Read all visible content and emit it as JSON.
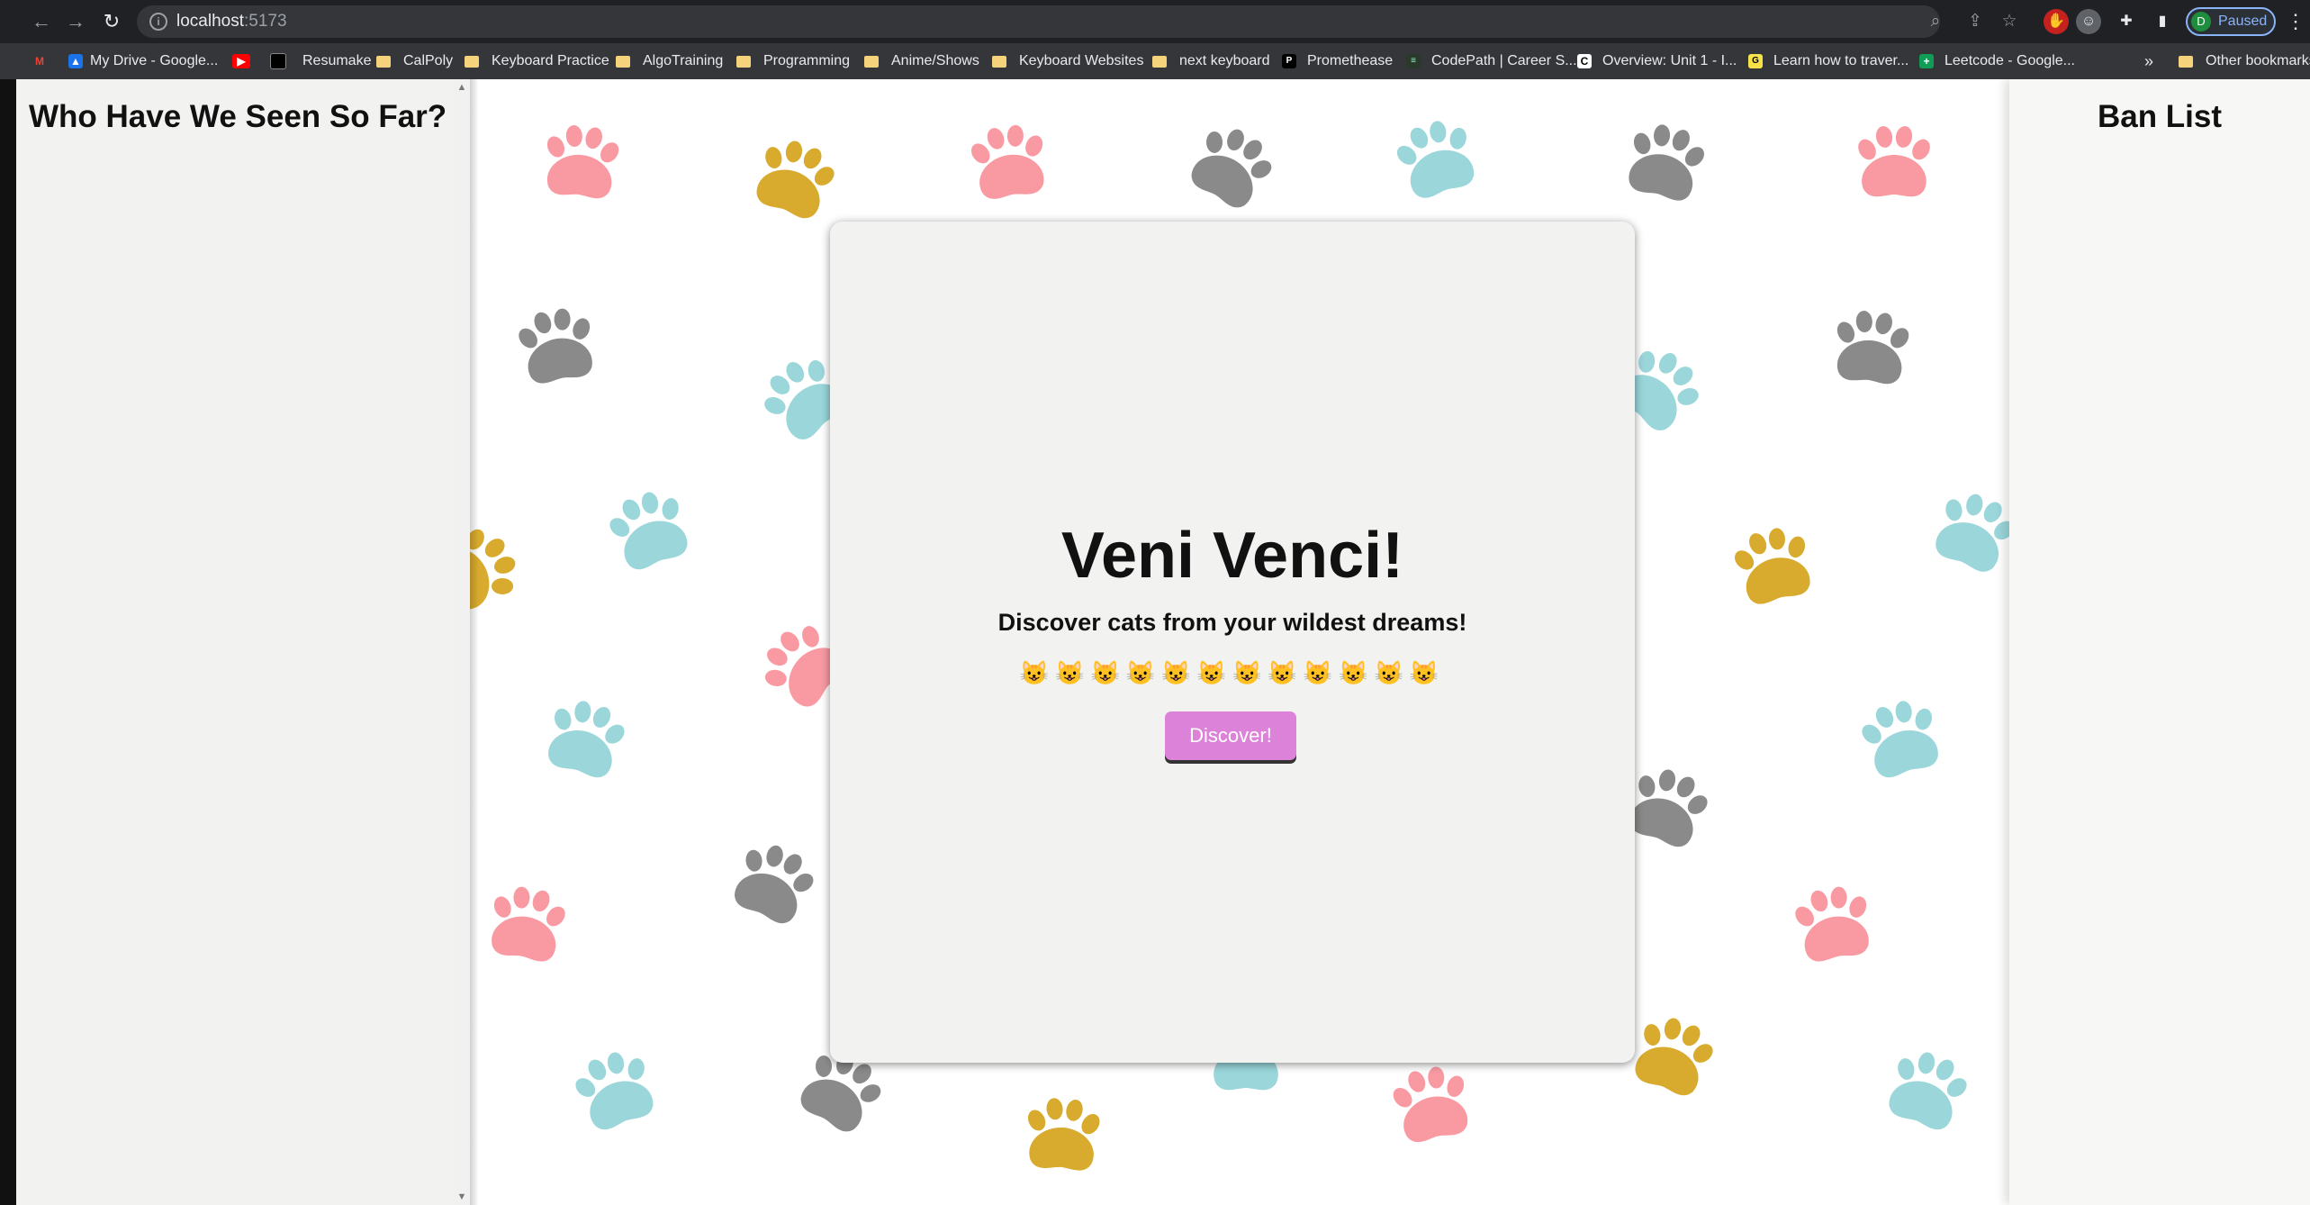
{
  "browser": {
    "url_host": "localhost",
    "url_port": ":5173",
    "profile_initial": "D",
    "profile_status": "Paused",
    "nav": {
      "back_glyph": "←",
      "forward_glyph": "→",
      "reload_glyph": "↻"
    }
  },
  "bookmarks": {
    "items": [
      {
        "label": "My Drive - Google...",
        "icon": "google-drive-icon"
      },
      {
        "label": "",
        "icon": "youtube-icon"
      },
      {
        "label": "Resumake",
        "icon": "resumake-icon"
      },
      {
        "label": "CalPoly",
        "icon": "folder-icon"
      },
      {
        "label": "Keyboard Practice",
        "icon": "folder-icon"
      },
      {
        "label": "AlgoTraining",
        "icon": "folder-icon"
      },
      {
        "label": "Programming",
        "icon": "folder-icon"
      },
      {
        "label": "Anime/Shows",
        "icon": "folder-icon"
      },
      {
        "label": "Keyboard Websites",
        "icon": "folder-icon"
      },
      {
        "label": "next keyboard",
        "icon": "folder-icon"
      },
      {
        "label": "Promethease",
        "icon": "promethease-icon"
      },
      {
        "label": "CodePath | Career S...",
        "icon": "codepath-icon"
      },
      {
        "label": "Overview: Unit 1 - I...",
        "icon": "codepath-c-icon"
      },
      {
        "label": "Learn how to traver...",
        "icon": "learn-icon"
      },
      {
        "label": "Leetcode - Google...",
        "icon": "sheets-icon"
      }
    ],
    "overflow": "»",
    "other": "Other bookmarks"
  },
  "left_panel": {
    "title": "Who Have We Seen So Far?"
  },
  "right_panel": {
    "title": "Ban List"
  },
  "card": {
    "title": "Veni Venci!",
    "subtitle": "Discover cats from your wildest dreams!",
    "emojis": "😺😺😺😺😺😺😺😺😺😺😺😺",
    "button": "Discover!"
  },
  "colors": {
    "paw_pink": "#f99aa3",
    "paw_gold": "#d8ab2e",
    "paw_gray": "#8a8a8a",
    "paw_teal": "#9ad6da",
    "button": "#dd82d9"
  }
}
